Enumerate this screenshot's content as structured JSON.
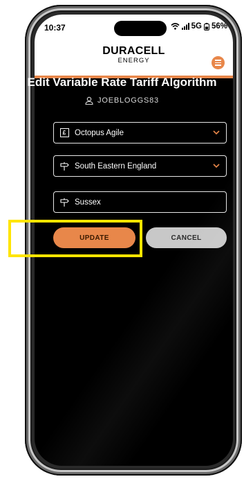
{
  "status": {
    "time": "10:37",
    "network": "5G",
    "battery": "56%"
  },
  "logo": {
    "main": "DURACELL",
    "sub": "ENERGY"
  },
  "page": {
    "title": "Edit Variable Rate Tariff Algorithm",
    "username": "JOEBLOGGS83"
  },
  "fields": {
    "tariff": {
      "value": "Octopus Agile",
      "icon": "pound-icon"
    },
    "region": {
      "value": "South Eastern England",
      "icon": "signpost-icon"
    },
    "county": {
      "value": "Sussex",
      "icon": "signpost-icon"
    }
  },
  "buttons": {
    "update": "UPDATE",
    "cancel": "CANCEL"
  },
  "colors": {
    "accent": "#e8874a",
    "highlight": "#ffe500",
    "cancel": "#c8c8c8"
  }
}
